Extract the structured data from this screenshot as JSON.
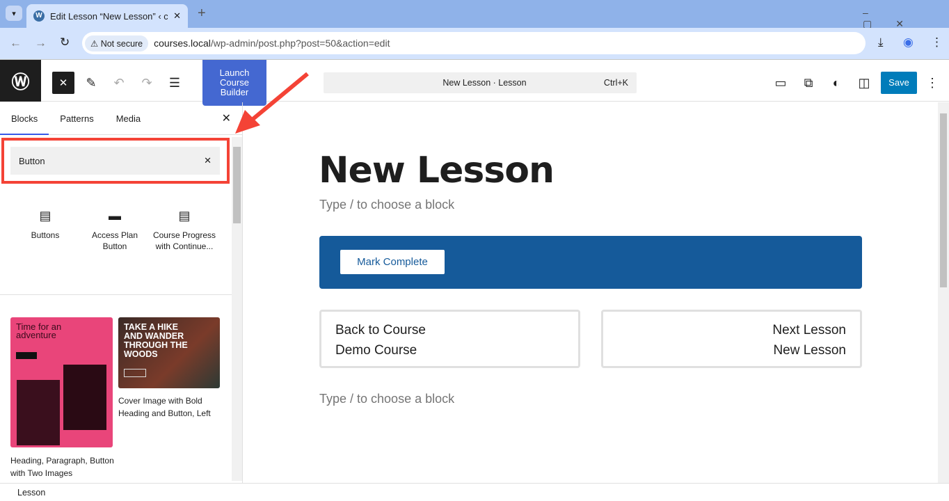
{
  "browser": {
    "tab_title": "Edit Lesson “New Lesson” ‹ cou",
    "security": "Not secure",
    "url_host": "courses.local",
    "url_path": "/wp-admin/post.php?post=50&action=edit"
  },
  "toolbar": {
    "launch_button": "Launch Course Builder",
    "command": "New Lesson · Lesson",
    "shortcut": "Ctrl+K",
    "save": "Save"
  },
  "sidebar": {
    "tabs": [
      "Blocks",
      "Patterns",
      "Media"
    ],
    "search_value": "Button",
    "blocks": [
      {
        "label": "Buttons"
      },
      {
        "label": "Access Plan Button"
      },
      {
        "label": "Course Progress with Continue..."
      }
    ],
    "patterns": [
      {
        "label": "Heading, Paragraph, Button with Two Images",
        "preview": "Time for an adventure"
      },
      {
        "label": "Cover Image with Bold Heading and Button, Left",
        "preview": "TAKE A HIKE AND WANDER THROUGH THE WOODS"
      }
    ]
  },
  "editor": {
    "title": "New Lesson",
    "placeholder": "Type / to choose a block",
    "mark_complete": "Mark Complete",
    "back_label": "Back to Course",
    "back_name": "Demo Course",
    "next_label": "Next Lesson",
    "next_name": "New Lesson"
  },
  "status": {
    "breadcrumb": "Lesson"
  },
  "colors": {
    "accent": "#007cba",
    "banner": "#155a9a",
    "highlight": "#f44336",
    "launch": "#4468d1"
  }
}
